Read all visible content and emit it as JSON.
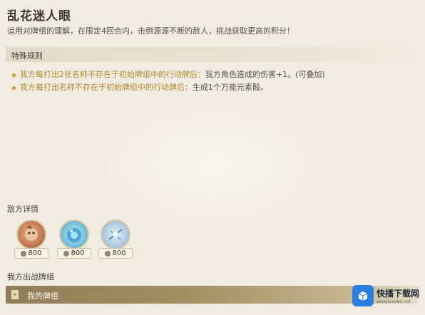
{
  "page": {
    "title": "乱花迷人眼",
    "description": "运用对牌组的理解，在限定4回合内，击倒源源不断的敌人，挑战获取更高的积分！"
  },
  "rules": {
    "header": "特殊规则",
    "items": [
      {
        "highlight": "我方每打出2张名称不存在于初始牌组中的行动牌后：",
        "text": "我方角色造成的伤害+1。(可叠加)"
      },
      {
        "highlight": "我方每打出名称不存在于初始牌组中的行动牌后：",
        "text": "生成1个万能元素骰。"
      }
    ]
  },
  "enemies": {
    "title": "敌方详情",
    "list": [
      {
        "icon": "rock-creature-icon",
        "hp": "800"
      },
      {
        "icon": "hydro-slime-icon",
        "hp": "800"
      },
      {
        "icon": "cryo-slime-icon",
        "hp": "800"
      }
    ]
  },
  "deck": {
    "title": "我方出战牌组",
    "label": "我的牌组"
  },
  "watermark": {
    "text": "快播下载网",
    "sub": "www.kuaibo.net"
  },
  "colors": {
    "background": "#f1ece2",
    "highlight": "#b08a2e",
    "deck_bar": "#8f7d57"
  }
}
